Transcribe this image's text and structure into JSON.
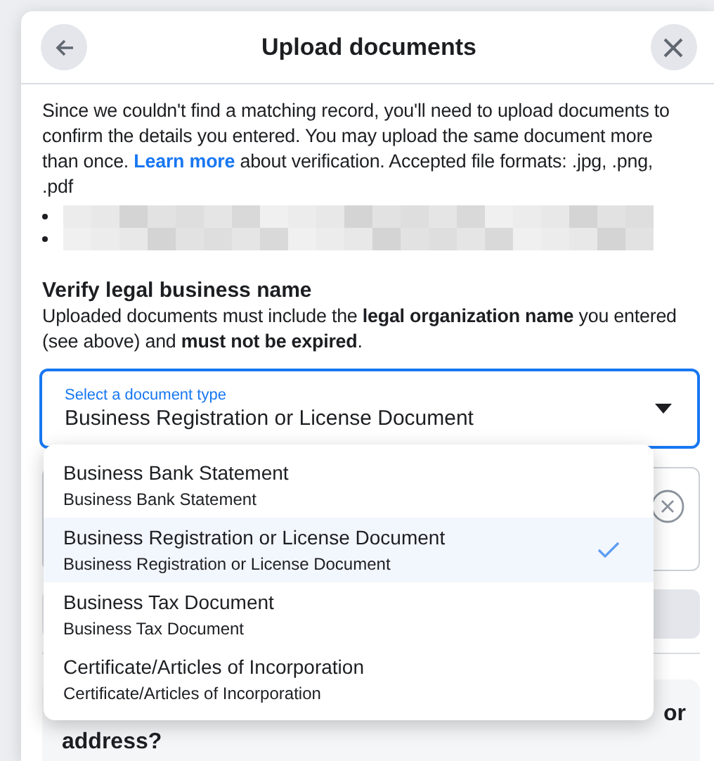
{
  "dialog": {
    "title": "Upload documents"
  },
  "intro": {
    "before": "Since we couldn't find a matching record, you'll need to upload documents to confirm the details you entered. You may upload the same document more than once.",
    "link": "Learn more",
    "after": "about verification. Accepted file formats: .jpg, .png, .pdf"
  },
  "bullets": [
    {
      "kind": "redacted"
    },
    {
      "kind": "redacted"
    }
  ],
  "section": {
    "heading": "Verify legal business name",
    "description": "Uploaded documents must include the **legal organization name** you entered (see above) and **must not be expired**."
  },
  "select": {
    "label": "Select a document type",
    "value": "Business Registration or License Document",
    "expanded": true
  },
  "options": [
    {
      "title": "Business Bank Statement",
      "subtitle": "Business Bank Statement",
      "selected": false
    },
    {
      "title": "Business Registration or License Document",
      "subtitle": "Business Registration or License Document",
      "selected": true
    },
    {
      "title": "Business Tax Document",
      "subtitle": "Business Tax Document",
      "selected": false
    },
    {
      "title": "Certificate/Articles of Incorporation",
      "subtitle": "Certificate/Articles of Incorporation",
      "selected": false
    }
  ],
  "next_card": {
    "line_end": "or",
    "line_2": "address?"
  }
}
